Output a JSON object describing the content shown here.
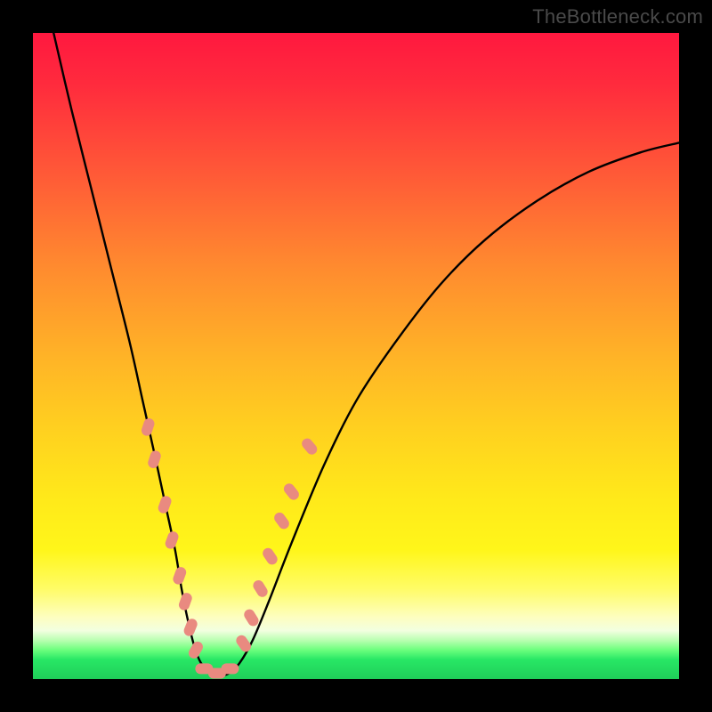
{
  "watermark": "TheBottleneck.com",
  "chart_data": {
    "type": "line",
    "title": "",
    "xlabel": "",
    "ylabel": "",
    "xlim": [
      0,
      100
    ],
    "ylim": [
      0,
      100
    ],
    "grid": false,
    "legend": false,
    "note": "Values are read off the rendered curve in percent of the plot area; x runs left→right 0–100, y is height above bottom 0–100. Bottleneck-style V: steep descending left arm, flat trough near x≈25–30 at y≈0, rising right arm that plateaus.",
    "series": [
      {
        "name": "curve",
        "color": "#000000",
        "x": [
          3.2,
          6,
          9,
          12,
          15,
          17,
          19,
          20.5,
          22,
          23,
          24,
          25,
          26,
          27.5,
          29,
          30.5,
          32,
          34,
          36.5,
          40,
          45,
          50,
          56,
          63,
          70,
          78,
          86,
          94,
          100
        ],
        "y": [
          100,
          88,
          76,
          64,
          52,
          43,
          34,
          27,
          20,
          14,
          9,
          5,
          2.5,
          1,
          0.5,
          1,
          2.5,
          6,
          12,
          21,
          33,
          43,
          52,
          61,
          68,
          74,
          78.5,
          81.5,
          83
        ]
      }
    ],
    "markers": {
      "note": "Rounded salmon lozenge markers placed along both arms of the V in the lower ~⅓ of the chart, plus three along the flat trough.",
      "color": "#e98a80",
      "shape": "rounded-lozenge",
      "points": [
        {
          "x": 17.8,
          "y": 39.0,
          "tilt": -72
        },
        {
          "x": 18.8,
          "y": 34.0,
          "tilt": -72
        },
        {
          "x": 20.4,
          "y": 27.0,
          "tilt": -70
        },
        {
          "x": 21.5,
          "y": 21.5,
          "tilt": -70
        },
        {
          "x": 22.7,
          "y": 16.0,
          "tilt": -70
        },
        {
          "x": 23.6,
          "y": 12.0,
          "tilt": -70
        },
        {
          "x": 24.4,
          "y": 8.0,
          "tilt": -68
        },
        {
          "x": 25.2,
          "y": 4.5,
          "tilt": -60
        },
        {
          "x": 26.5,
          "y": 1.6,
          "tilt": 0
        },
        {
          "x": 28.5,
          "y": 0.9,
          "tilt": 0
        },
        {
          "x": 30.5,
          "y": 1.6,
          "tilt": 0
        },
        {
          "x": 32.6,
          "y": 5.5,
          "tilt": 55
        },
        {
          "x": 33.8,
          "y": 9.5,
          "tilt": 58
        },
        {
          "x": 35.2,
          "y": 14.0,
          "tilt": 58
        },
        {
          "x": 36.7,
          "y": 19.0,
          "tilt": 56
        },
        {
          "x": 38.5,
          "y": 24.5,
          "tilt": 54
        },
        {
          "x": 40.0,
          "y": 29.0,
          "tilt": 52
        },
        {
          "x": 42.8,
          "y": 36.0,
          "tilt": 50
        }
      ]
    }
  }
}
